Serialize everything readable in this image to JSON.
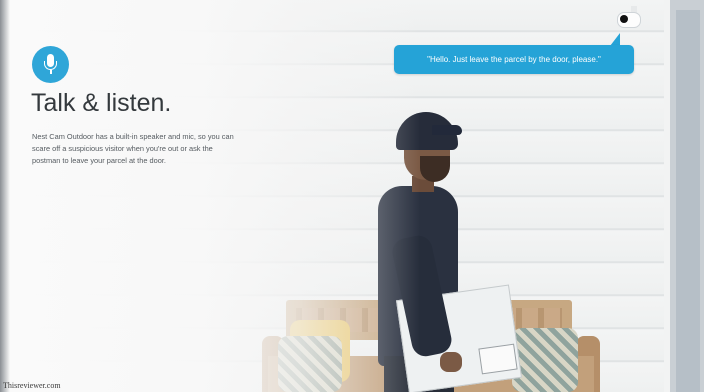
{
  "bubble": {
    "text": "\"Hello. Just leave the parcel by the door, please.\""
  },
  "section": {
    "icon": "microphone-icon",
    "title": "Talk & listen.",
    "body_lines": [
      "Nest Cam Outdoor has a built-in speaker and mic, so you can",
      "scare off a suspicious visitor when you're out or ask the",
      "postman to leave your parcel at the door."
    ]
  },
  "watermark": "Thisreviewer.com",
  "colors": {
    "accent": "#2fa6d8",
    "title": "#34393d",
    "body": "#555b60"
  }
}
